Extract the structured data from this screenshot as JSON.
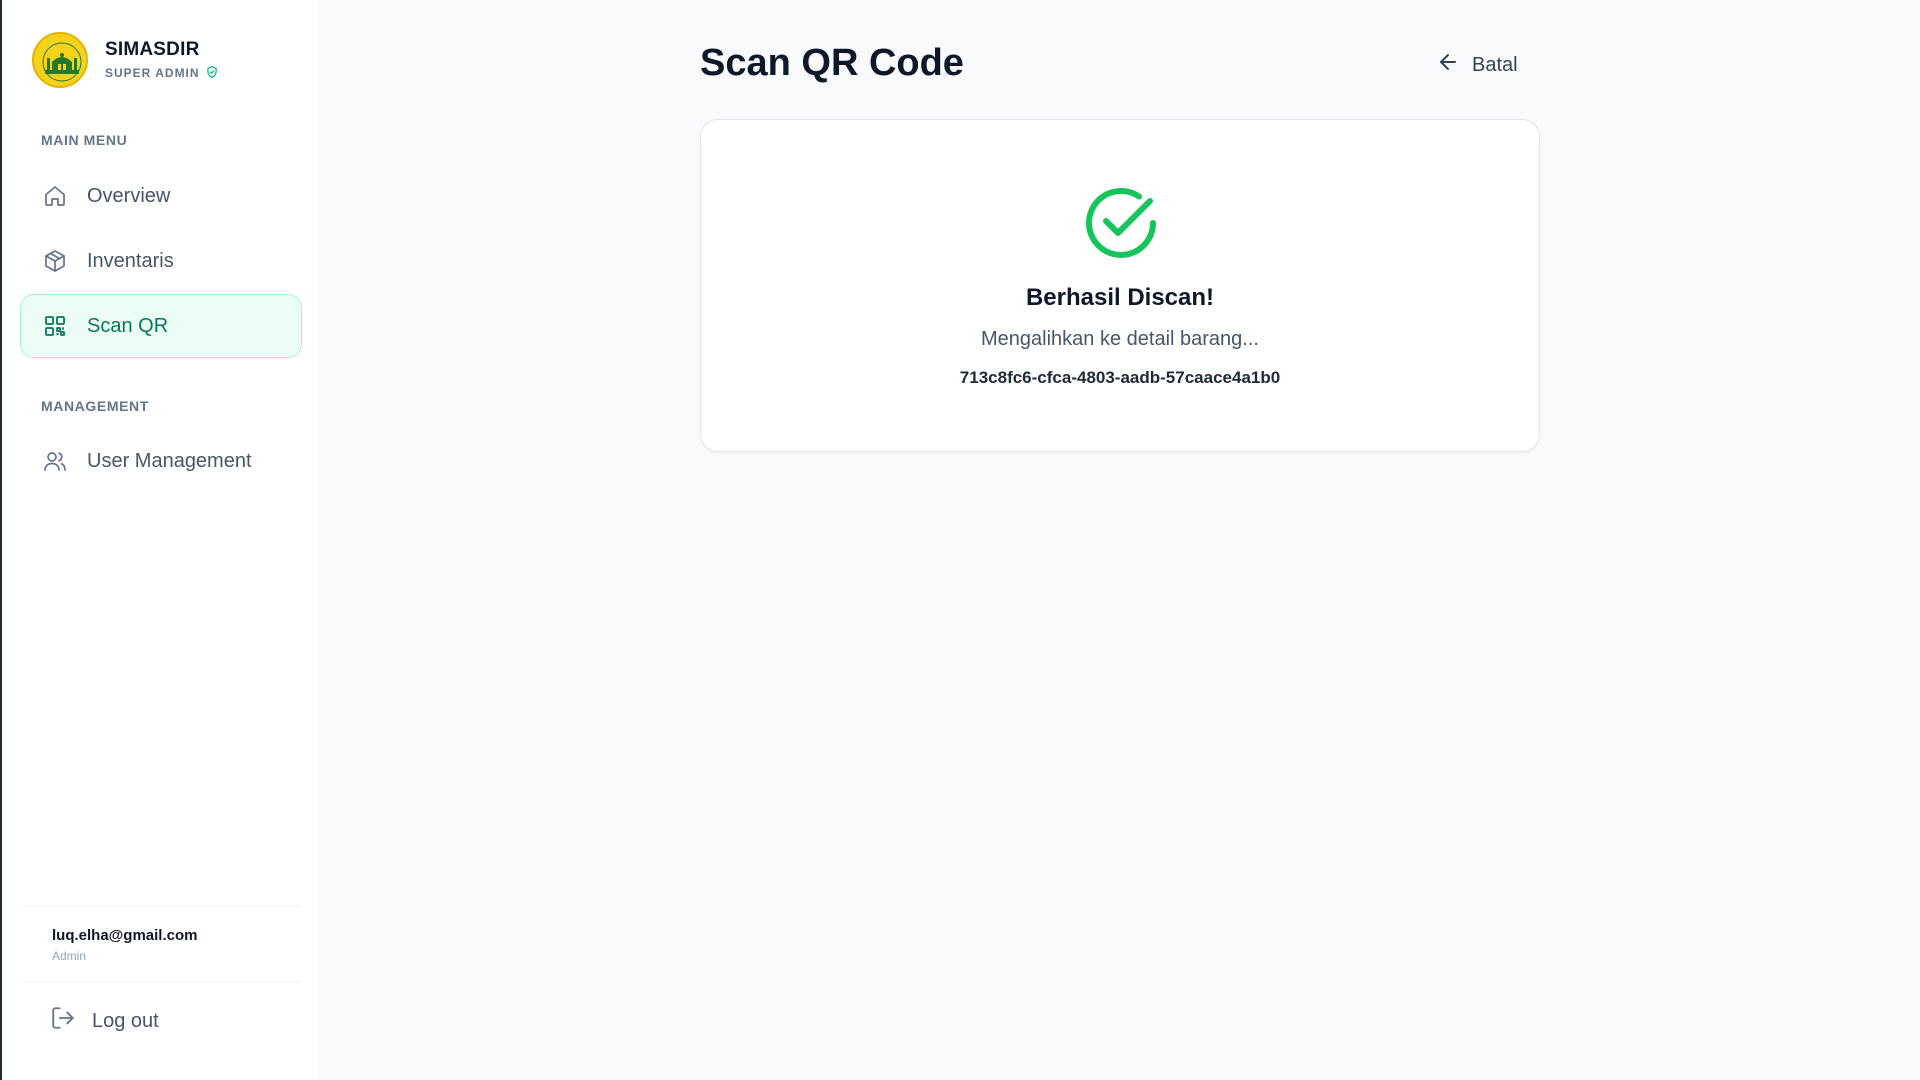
{
  "brand": {
    "name": "SIMASDIR",
    "role": "SUPER ADMIN"
  },
  "sidebar": {
    "main_menu_label": "MAIN MENU",
    "management_label": "MANAGEMENT",
    "items": [
      {
        "label": "Overview",
        "icon": "home-icon",
        "active": false
      },
      {
        "label": "Inventaris",
        "icon": "box-icon",
        "active": false
      },
      {
        "label": "Scan QR",
        "icon": "qr-code-icon",
        "active": true
      },
      {
        "label": "User Management",
        "icon": "users-icon",
        "active": false
      }
    ],
    "user": {
      "email": "luq.elha@gmail.com",
      "role": "Admin"
    },
    "logout_label": "Log out"
  },
  "header": {
    "title": "Scan QR Code",
    "cancel_label": "Batal"
  },
  "result": {
    "title": "Berhasil Discan!",
    "message": "Mengalihkan ke detail barang...",
    "code": "713c8fc6-cfca-4803-aadb-57caace4a1b0"
  },
  "colors": {
    "accent": "#047857",
    "active_bg": "#ecfdf5",
    "success": "#16c45a",
    "logo_yellow": "#f6d31a"
  }
}
